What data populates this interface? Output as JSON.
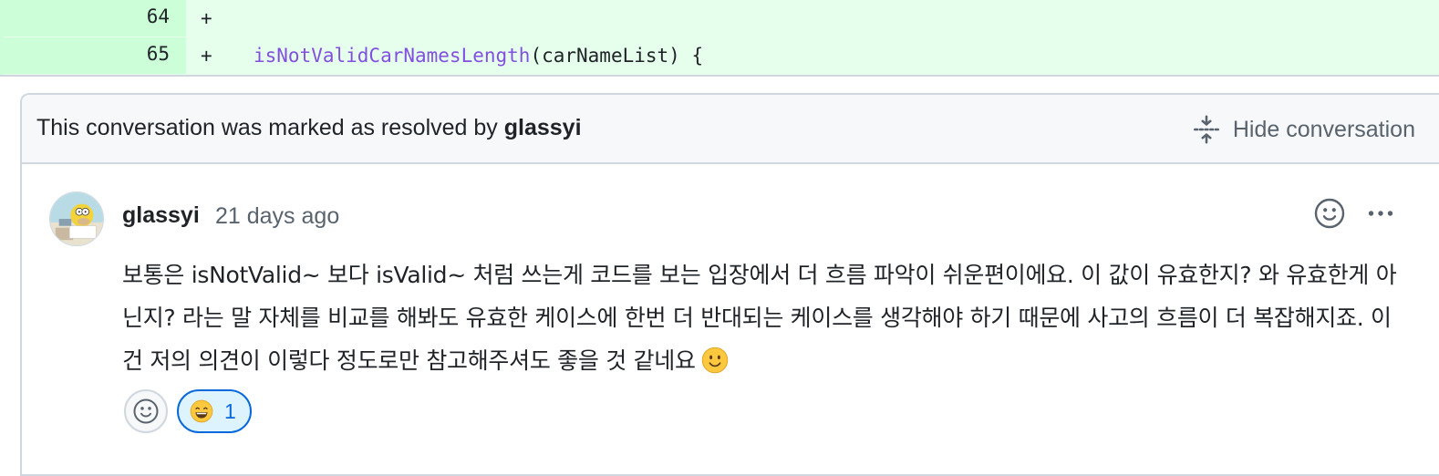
{
  "diff": {
    "lines": [
      {
        "number": "64",
        "marker": "+",
        "code_fn": "",
        "code_rest": ""
      },
      {
        "number": "65",
        "marker": "+",
        "code_fn": "isNotValidCarNamesLength",
        "code_rest": "(carNameList) {"
      }
    ]
  },
  "conversation": {
    "resolved_prefix": "This conversation was marked as resolved by ",
    "resolved_by": "glassyi",
    "hide_label": "Hide conversation"
  },
  "comment": {
    "author": "glassyi",
    "time": "21 days ago",
    "body": "보통은 isNotValid~ 보다 isValid~ 처럼 쓰는게 코드를 보는 입장에서 더 흐름 파악이 쉬운편이에요. 이 값이 유효한지? 와 유효한게 아닌지? 라는 말 자체를 비교를 해봐도 유효한 케이스에 한번 더 반대되는 케이스를 생각해야 하기 때문에 사고의 흐름이 더 복잡해지죠. 이건 저의 의견이 이렇다 정도로만 참고해주셔도 좋을 것 같네요",
    "reactions": [
      {
        "emoji": "😄",
        "count": "1"
      }
    ]
  },
  "colors": {
    "added_bg": "#e6ffec",
    "added_gutter": "#ccffd8",
    "accent": "#0969da",
    "function_name": "#8250df"
  }
}
